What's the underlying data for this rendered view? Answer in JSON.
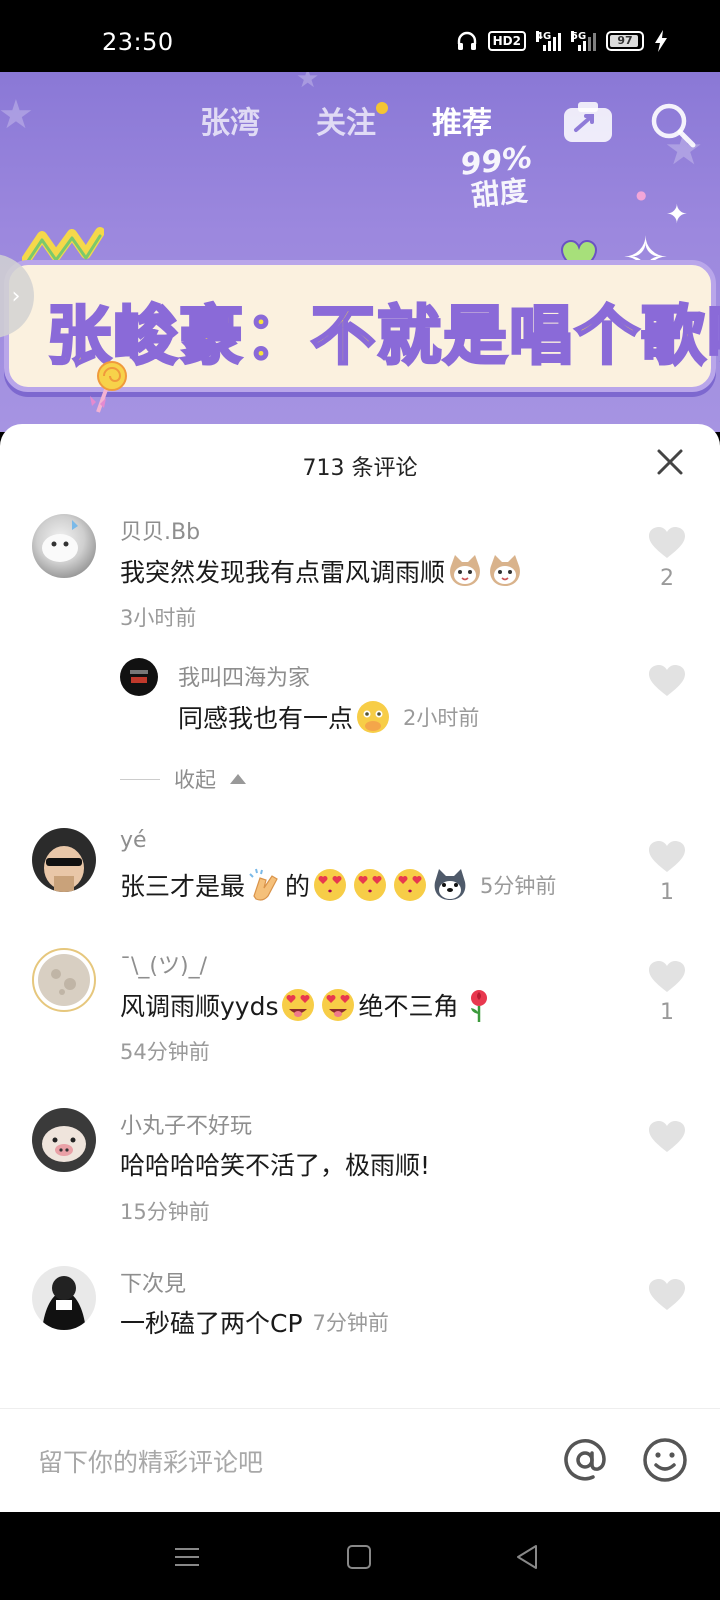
{
  "status_bar": {
    "time": "23:50",
    "hd_label": "HD2",
    "signal1_label": "4G",
    "signal2_label": "5G",
    "battery_level": "97",
    "icons": [
      "headphone-icon",
      "hd-icon",
      "signal-4g-icon",
      "signal-5g-icon",
      "battery-icon",
      "charging-icon"
    ]
  },
  "video": {
    "tabs": [
      "张湾",
      "关注",
      "推荐"
    ],
    "active_tab_index": 2,
    "sweet_percent": "99%",
    "sweet_label": "甜度",
    "banner_title": "张峻豪：不就是唱个歌嘛",
    "side_tab_icon": "chevron-right-icon"
  },
  "comments_sheet": {
    "title": "713 条评论",
    "collapse_label": "收起",
    "input_placeholder": "留下你的精彩评论吧",
    "comments": [
      {
        "name": "贝贝.Bb",
        "text": "我突然发现我有点雷风调雨顺",
        "emojis": [
          "cat-emoji",
          "cat-emoji"
        ],
        "time": "3小时前",
        "likes": "2"
      },
      {
        "name": "我叫四海为家",
        "text": "同感我也有一点",
        "emojis": [
          "shy-face-emoji"
        ],
        "time": "2小时前",
        "likes": ""
      },
      {
        "name": "yé",
        "text_before": "张三才是最",
        "text_after": "的",
        "emojis_before": [
          "clap-emoji"
        ],
        "emojis_after": [
          "heart-eyes-emoji",
          "heart-eyes-emoji",
          "heart-eyes-emoji",
          "husky-emoji"
        ],
        "time": "5分钟前",
        "likes": "1"
      },
      {
        "name": "¯\\_(ツ)_/",
        "text_before": "风调雨顺yyds",
        "text_after": "绝不三角",
        "emojis_mid": [
          "heart-eyes-tongue-emoji",
          "heart-eyes-tongue-emoji"
        ],
        "emojis_end": [
          "rose-emoji"
        ],
        "time": "54分钟前",
        "likes": "1"
      },
      {
        "name": "小丸子不好玩",
        "text": "哈哈哈哈笑不活了，极雨顺!",
        "time": "15分钟前",
        "likes": ""
      },
      {
        "name": "下次見",
        "text": "一秒磕了两个CP",
        "time": "7分钟前",
        "likes": ""
      }
    ]
  },
  "colors": {
    "video_bg": "#9c88de",
    "banner_text": "#f7e43c",
    "banner_stroke": "#8a6ad8",
    "muted_text": "#9a9a9a",
    "heart_gray": "#e2e2e2"
  }
}
